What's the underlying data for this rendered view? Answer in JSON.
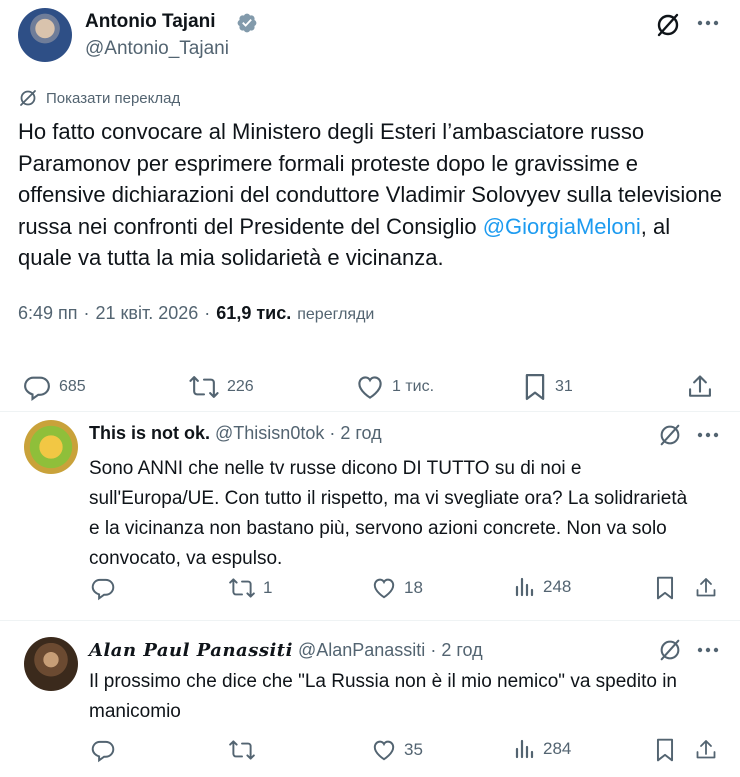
{
  "main_tweet": {
    "name": "Antonio Tajani",
    "handle": "@Antonio_Tajani",
    "translate_label": "Показати переклад",
    "text_before": "Ho fatto convocare al Ministero degli Esteri l’ambasciatore russo Paramonov per esprimere formali proteste dopo le gravissime e offensive dichiarazioni del conduttore Vladimir Solovyev sulla televisione russa nei confronti del Presidente del Consiglio ",
    "mention": "@GiorgiaMeloni",
    "text_after": ", al quale va tutta la mia solidarietà e vicinanza.",
    "time": "6:49 пп",
    "date": "21 квіт. 2026",
    "views": "61,9 тис.",
    "views_label": "перегляди",
    "actions": {
      "replies": "685",
      "retweets": "226",
      "likes": "1 тис.",
      "bookmarks": "31"
    }
  },
  "replies": [
    {
      "name": "This is not ok.",
      "handle": "@Thisisn0tok",
      "time": "2 год",
      "text": "Sono ANNI che nelle tv russe dicono DI TUTTO su di noi e sull'Europa/UE. Con tutto il rispetto, ma vi svegliate ora? La solidrarietà e la vicinanza non bastano più, servono azioni concrete. Non va solo convocato, va espulso.",
      "retweets": "1",
      "likes": "18",
      "views": "248"
    },
    {
      "name": "Alan Paul Panassiti",
      "handle": "@AlanPanassiti",
      "time": "2 год",
      "text": "Il prossimo che dice che \"La Russia non è il mio nemico\" va spedito in manicomio",
      "likes": "35",
      "views": "284"
    }
  ],
  "separator": "·",
  "colors": {
    "text": "#0f1419",
    "muted": "#536471",
    "link": "#1d9bf0",
    "verified_gray": "#829aab",
    "border": "#eff3f4"
  },
  "icons": [
    "verified-badge-icon",
    "grok-icon",
    "more-icon",
    "translate-icon",
    "reply-icon",
    "retweet-icon",
    "like-icon",
    "bookmark-icon",
    "share-icon",
    "views-icon"
  ]
}
